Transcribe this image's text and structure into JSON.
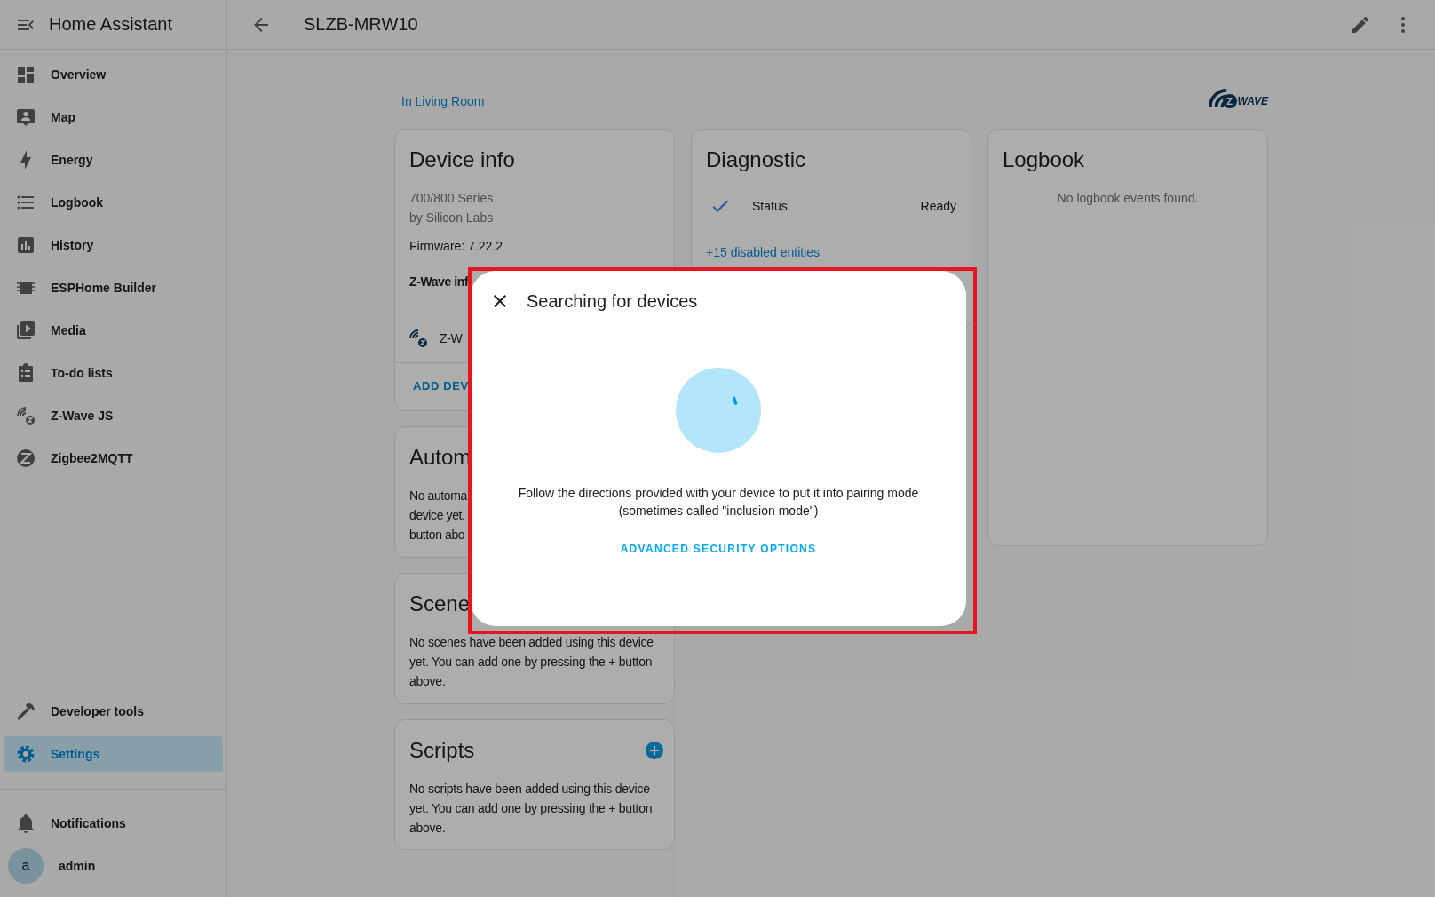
{
  "sidebar": {
    "title": "Home Assistant",
    "items": [
      {
        "label": "Overview",
        "selected": false
      },
      {
        "label": "Map",
        "selected": false
      },
      {
        "label": "Energy",
        "selected": false
      },
      {
        "label": "Logbook",
        "selected": false
      },
      {
        "label": "History",
        "selected": false
      },
      {
        "label": "ESPHome Builder",
        "selected": false
      },
      {
        "label": "Media",
        "selected": false
      },
      {
        "label": "To-do lists",
        "selected": false
      },
      {
        "label": "Z-Wave JS",
        "selected": false
      },
      {
        "label": "Zigbee2MQTT",
        "selected": false
      }
    ],
    "bottom_items": [
      {
        "label": "Developer tools",
        "selected": false
      },
      {
        "label": "Settings",
        "selected": true
      }
    ],
    "notifications": "Notifications",
    "user": {
      "initial": "a",
      "name": "admin"
    }
  },
  "header": {
    "title": "SLZB-MRW10"
  },
  "area_link": "In Living Room",
  "logo": {
    "badge": "Z",
    "wordmark": "WAVE"
  },
  "device_info": {
    "title": "Device info",
    "model": "700/800 Series",
    "manufacturer": "by Silicon Labs",
    "firmware": "Firmware: 7.22.2",
    "section_title": "Z-Wave inf",
    "row_label": "Z-W",
    "action": "ADD DEV"
  },
  "diagnostic": {
    "title": "Diagnostic",
    "entities": [
      {
        "name": "Status",
        "state": "Ready"
      }
    ],
    "disabled_link": "+15 disabled entities"
  },
  "logbook": {
    "title": "Logbook",
    "empty": "No logbook events found."
  },
  "automations": {
    "title": "Autom",
    "lines": [
      "No automa",
      "device yet.",
      "button abo"
    ]
  },
  "scenes": {
    "title": "Scene",
    "lines": [
      "No scenes have been added using this device",
      "yet. You can add one by pressing the + button",
      "above."
    ]
  },
  "scripts": {
    "title": "Scripts",
    "lines": [
      "No scripts have been added using this device",
      "yet. You can add one by pressing the + button",
      "above."
    ]
  },
  "dialog": {
    "title": "Searching for devices",
    "message_lines": [
      "Follow the directions provided with your device to put it into pairing mode",
      "(sometimes called \"inclusion mode\")"
    ],
    "action": "ADVANCED SECURITY OPTIONS"
  }
}
